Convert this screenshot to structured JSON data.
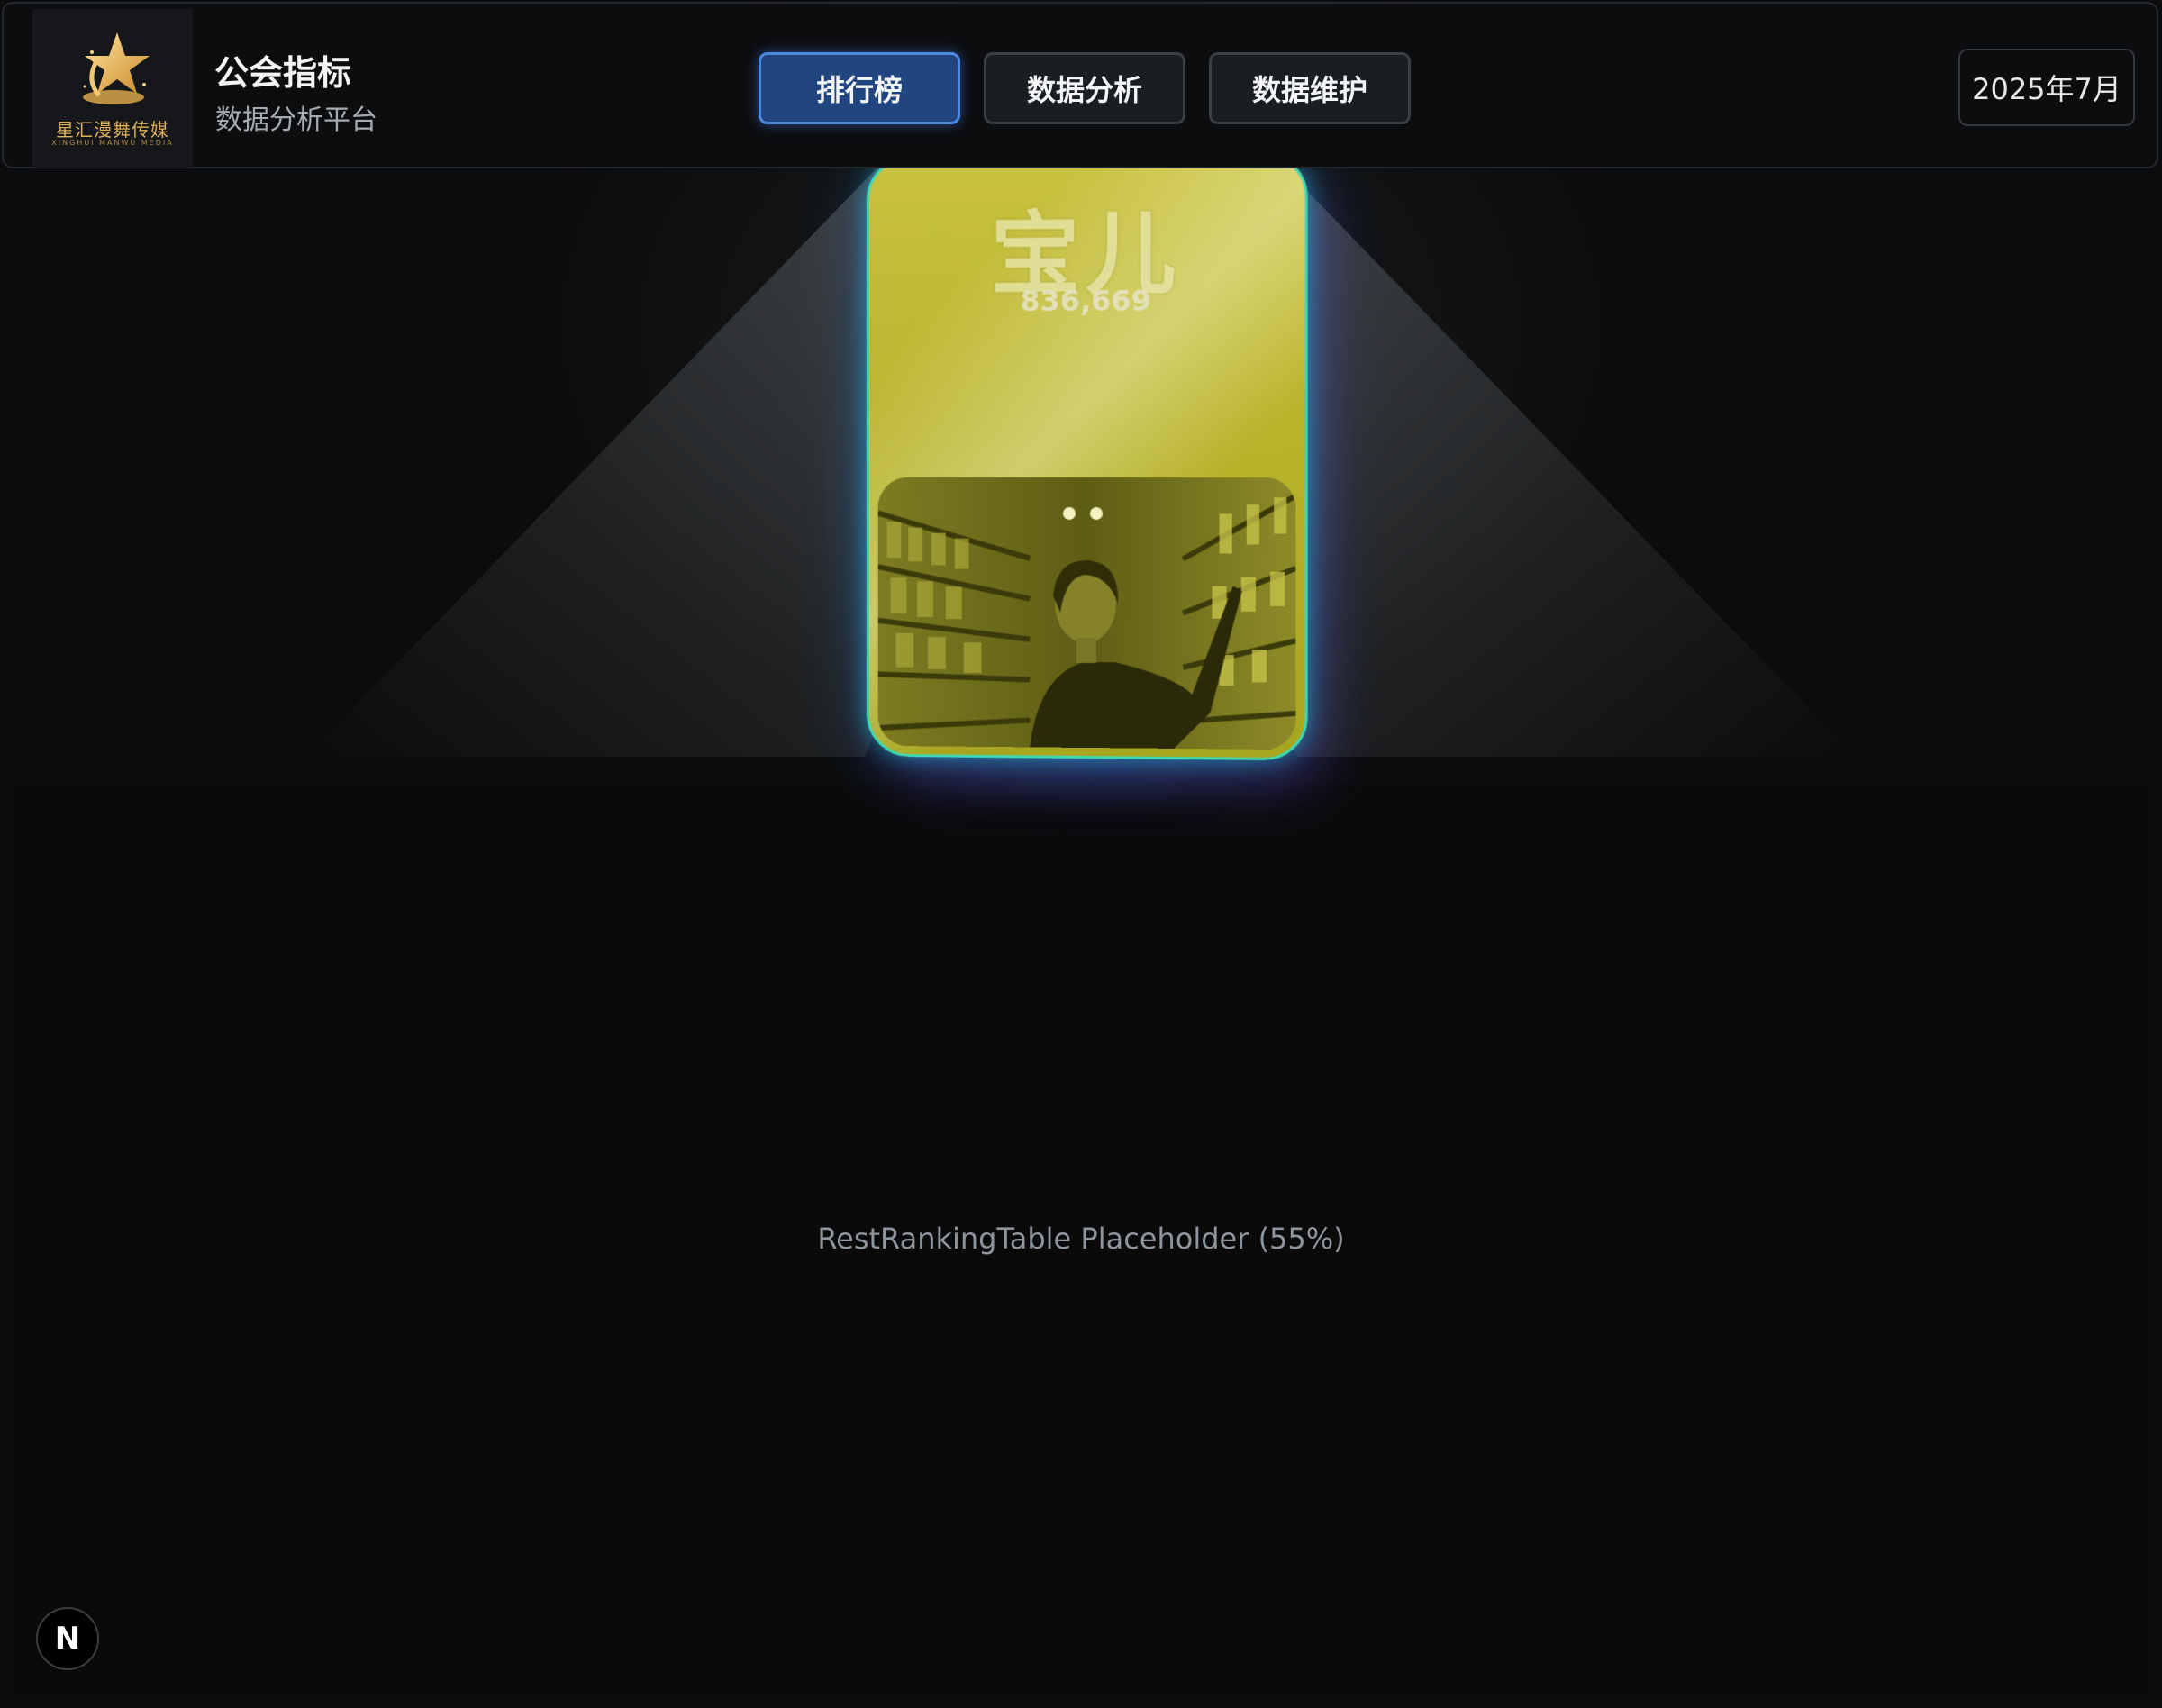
{
  "brand": {
    "logo_text": "星汇漫舞传媒",
    "logo_subtext": "XINGHUI MANWU MEDIA",
    "title": "公会指标",
    "subtitle": "数据分析平台"
  },
  "nav": {
    "tabs": [
      {
        "label": "排行榜",
        "active": true
      },
      {
        "label": "数据分析",
        "active": false
      },
      {
        "label": "数据维护",
        "active": false
      }
    ]
  },
  "period": {
    "label": "2025年7月"
  },
  "top_card": {
    "name": "宝儿",
    "score": "836,669",
    "accent_color": "#3fd8b4",
    "glow_color": "#1eaae6",
    "tint_color": "#c8c23e"
  },
  "rest_table": {
    "placeholder": "RestRankingTable Placeholder (55%)"
  },
  "dev_badge": {
    "label": "N"
  },
  "colors": {
    "background": "#0b0c0d",
    "active_tab": "#21467f",
    "active_tab_border": "#4a8ae0"
  }
}
